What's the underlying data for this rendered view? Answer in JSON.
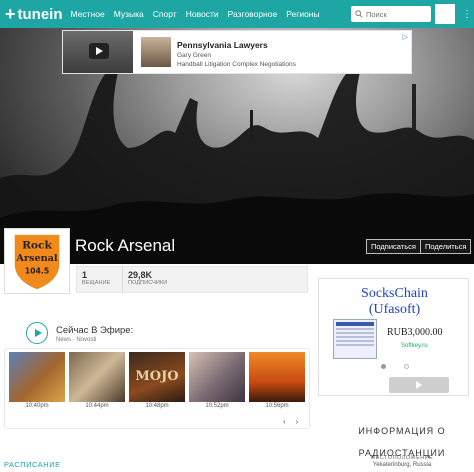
{
  "nav": {
    "logo": "tunein",
    "links": [
      "Местное",
      "Музыка",
      "Спорт",
      "Новости",
      "Разговорное",
      "Регионы"
    ],
    "search_placeholder": "Поиск"
  },
  "ad_banner": {
    "title": "Pennsylvania Lawyers",
    "line1": "Gary Green",
    "line2": "Handball Litigation Complex Negotiations"
  },
  "station": {
    "name": "Rock Arsenal",
    "subscribe_label": "Подписаться",
    "share_label": "Поделиться",
    "logo_text": "Rock Arsenal 104.5"
  },
  "stats": [
    {
      "value": "1",
      "label": "ВЕЩАНИЕ"
    },
    {
      "value": "29,8K",
      "label": "ПОДПИСЧИКИ"
    }
  ],
  "now_playing": {
    "title": "Сейчас В Эфире:",
    "subtitle": "News - Novosti"
  },
  "history": [
    {
      "time": "10:40pm"
    },
    {
      "time": "10:44pm"
    },
    {
      "time": "10:48pm"
    },
    {
      "time": "10:52pm"
    },
    {
      "time": "10:56pm"
    }
  ],
  "tile3_text": "MOJO",
  "schedule_label": "РАСПИСАНИЕ",
  "right_ad": {
    "title_line1": "SocksChain",
    "title_line2": "(Ufasoft)",
    "price": "RUB3,000.00",
    "site": "Softkey.ru"
  },
  "info": {
    "title": "ИНФОРМАЦИЯ О РАДИОСТАНЦИИ",
    "location_label": "МЕСТОПОЛОЖЕНИЕ",
    "location": "Yekaterinburg, Russia"
  },
  "colors": {
    "accent": "#1da6a3",
    "logo_orange": "#f08a1c"
  }
}
